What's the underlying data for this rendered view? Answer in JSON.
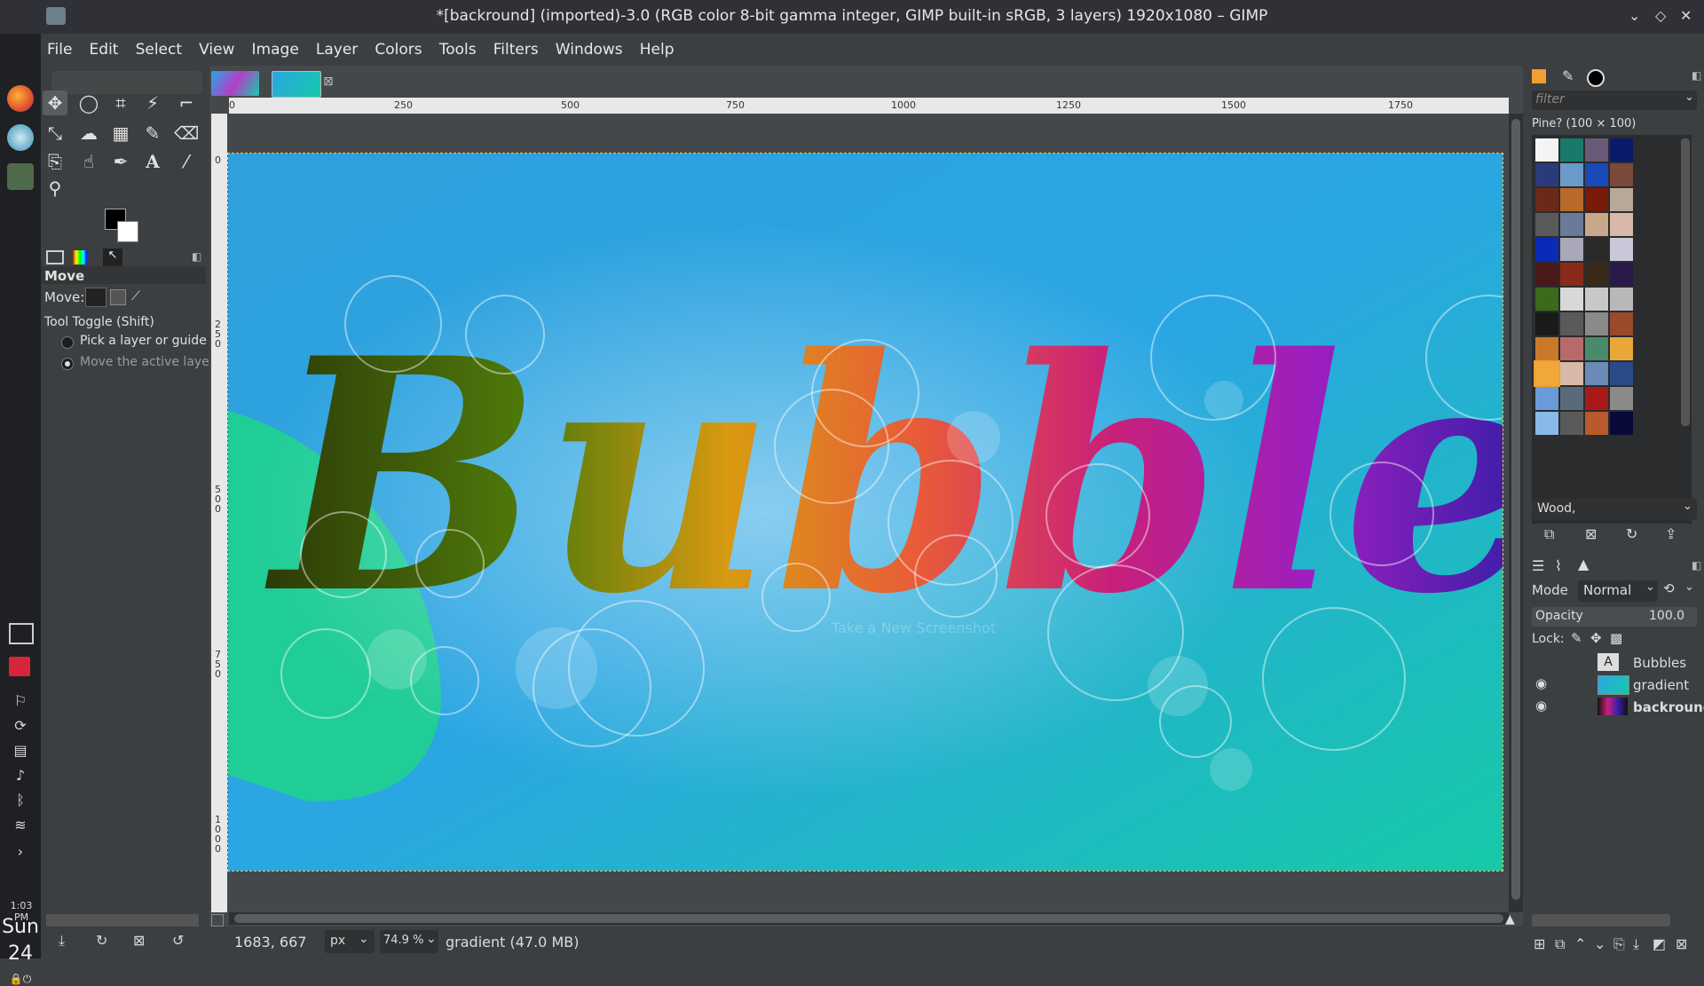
{
  "window": {
    "title": "*[backround] (imported)-3.0 (RGB color 8-bit gamma integer, GIMP built-in sRGB, 3 layers) 1920x1080 – GIMP",
    "controls": [
      "⌄",
      "◇",
      "✕"
    ]
  },
  "menu": [
    "File",
    "Edit",
    "Select",
    "View",
    "Image",
    "Layer",
    "Colors",
    "Tools",
    "Filters",
    "Windows",
    "Help"
  ],
  "system_clock": {
    "time": "1:03 PM",
    "day": "Sun",
    "date": "24"
  },
  "tool_options": {
    "tool_name": "Move",
    "move_label": "Move:",
    "toggle_label": "Tool Toggle  (Shift)",
    "options": [
      "Pick a layer or guide",
      "Move the active laye"
    ],
    "selected_option": 1
  },
  "ruler": {
    "h_ticks": [
      "0",
      "250",
      "500",
      "750",
      "1000",
      "1250",
      "1500",
      "1750"
    ],
    "v_ticks": [
      "0",
      "250",
      "500",
      "750",
      "1000"
    ]
  },
  "canvas": {
    "text": "Bubbles",
    "watermark": "Take a New Screenshot",
    "colors": {
      "bg1": "#2aa6e3",
      "bg2": "#16c9a8",
      "green": "#1fd28e"
    }
  },
  "statusbar": {
    "coords": "1683, 667",
    "unit": "px",
    "zoom": "74.9 %",
    "info": "gradient (47.0 MB)"
  },
  "patterns": {
    "filter_placeholder": "filter",
    "selected_name": "Pine? (100 × 100)",
    "tag": "Wood,"
  },
  "layers": {
    "mode_label": "Mode",
    "mode_value": "Normal",
    "opacity_label": "Opacity",
    "opacity_value": "100.0",
    "lock_label": "Lock:",
    "items": [
      {
        "name": "Bubbles",
        "visible": false
      },
      {
        "name": "gradient",
        "visible": true
      },
      {
        "name": "backround",
        "visible": true
      }
    ]
  }
}
